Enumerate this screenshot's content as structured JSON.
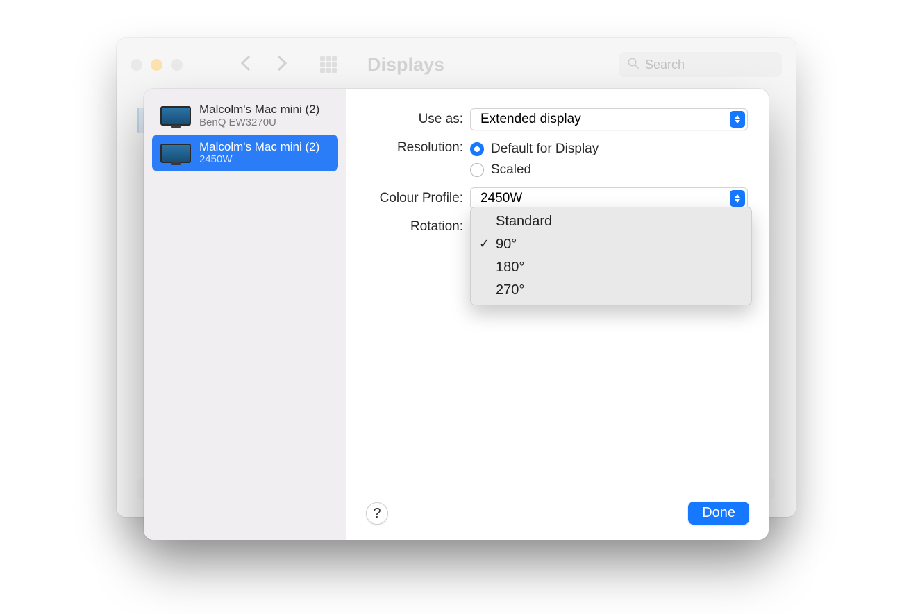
{
  "window": {
    "title": "Displays"
  },
  "search": {
    "placeholder": "Search"
  },
  "sidebar": {
    "items": [
      {
        "name": "Malcolm's Mac mini (2)",
        "sub": "BenQ EW3270U",
        "selected": false
      },
      {
        "name": "Malcolm's Mac mini (2)",
        "sub": "2450W",
        "selected": true
      }
    ]
  },
  "settings": {
    "use_as_label": "Use as:",
    "use_as_value": "Extended display",
    "resolution_label": "Resolution:",
    "resolution_options": {
      "default": "Default for Display",
      "scaled": "Scaled"
    },
    "colour_profile_label": "Colour Profile:",
    "colour_profile_value": "2450W",
    "rotation_label": "Rotation:",
    "rotation_options": [
      "Standard",
      "90°",
      "180°",
      "270°"
    ],
    "rotation_selected": "90°"
  },
  "buttons": {
    "help": "?",
    "done": "Done"
  }
}
